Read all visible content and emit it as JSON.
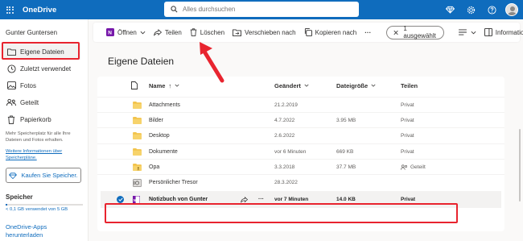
{
  "app": {
    "brand": "OneDrive",
    "colors": {
      "accent": "#0f6cbd",
      "highlight": "#e8242f",
      "folder": "#f2c34b"
    }
  },
  "search": {
    "placeholder": "Alles durchsuchen"
  },
  "topbar": {
    "icons": [
      "premium-diamond-icon",
      "settings-gear-icon",
      "help-icon",
      "avatar"
    ]
  },
  "sidebar": {
    "user_name": "Gunter Guntersen",
    "items": [
      {
        "label": "Eigene Dateien",
        "icon": "folder-icon",
        "active": true
      },
      {
        "label": "Zuletzt verwendet",
        "icon": "clock-icon",
        "active": false
      },
      {
        "label": "Fotos",
        "icon": "photo-icon",
        "active": false
      },
      {
        "label": "Geteilt",
        "icon": "shared-icon",
        "active": false
      },
      {
        "label": "Papierkorb",
        "icon": "trash-icon",
        "active": false
      }
    ],
    "storage_note": "Mehr Speicherplatz für alle Ihre Dateien und Fotos erhalten.",
    "storage_link": "Weitere Informationen über Speicherpläne.",
    "buy_button": "Kaufen Sie Speicher.",
    "storage_title": "Speicher",
    "storage_used": "< 0,1 GB verwendet von 5 GB",
    "storage_used_fraction": 0.02,
    "apps_link": "OneDrive-Apps herunterladen"
  },
  "commandbar": {
    "open": "Öffnen",
    "share": "Teilen",
    "delete": "Löschen",
    "move": "Verschieben nach",
    "copy": "Kopieren nach",
    "more": "···",
    "selected": "1 ausgewählt",
    "info": "Informationen"
  },
  "main": {
    "title": "Eigene Dateien",
    "columns": {
      "name": "Name",
      "modified": "Geändert",
      "size": "Dateigröße",
      "sharing": "Teilen"
    },
    "rows": [
      {
        "name": "Attachments",
        "modified": "21.2.2019",
        "size": "",
        "sharing": "Privat",
        "icon": "folder-icon",
        "selected": false,
        "shared_icon": false
      },
      {
        "name": "Bilder",
        "modified": "4.7.2022",
        "size": "3.95 MB",
        "sharing": "Privat",
        "icon": "folder-icon",
        "selected": false,
        "shared_icon": false
      },
      {
        "name": "Desktop",
        "modified": "2.6.2022",
        "size": "",
        "sharing": "Privat",
        "icon": "folder-icon",
        "selected": false,
        "shared_icon": false
      },
      {
        "name": "Dokumente",
        "modified": "vor 6 Minuten",
        "size": "669 KB",
        "sharing": "Privat",
        "icon": "folder-icon",
        "selected": false,
        "shared_icon": false
      },
      {
        "name": "Opa",
        "modified": "3.3.2018",
        "size": "37.7 MB",
        "sharing": "Geteilt",
        "icon": "shared-folder-icon",
        "selected": false,
        "shared_icon": true
      },
      {
        "name": "Persönlicher Tresor",
        "modified": "28.3.2022",
        "size": "",
        "sharing": "",
        "icon": "vault-icon",
        "selected": false,
        "shared_icon": false
      },
      {
        "name": "Notizbuch von Gunter",
        "modified": "vor 7 Minuten",
        "size": "14.0 KB",
        "sharing": "Privat",
        "icon": "onenote-icon",
        "selected": true,
        "shared_icon": false
      }
    ]
  }
}
